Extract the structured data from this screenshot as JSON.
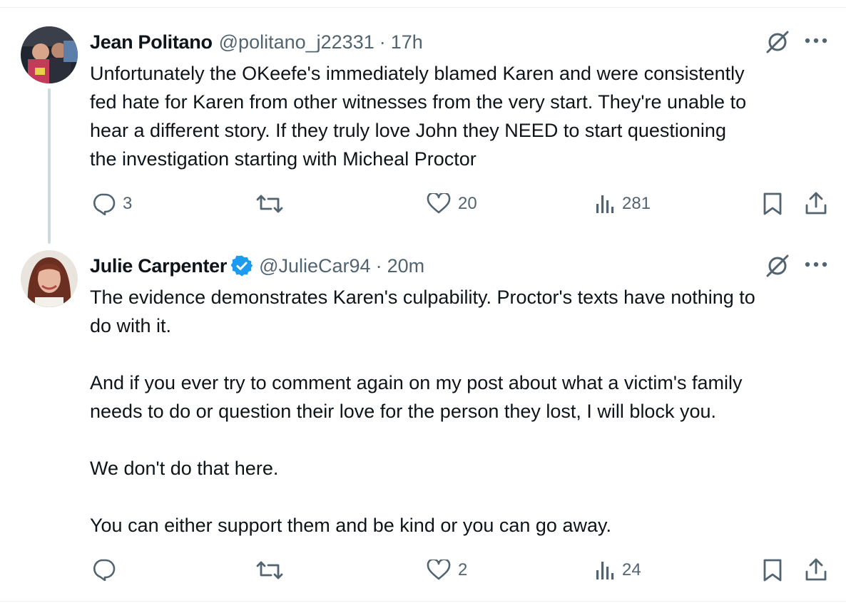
{
  "tweets": [
    {
      "name": "Jean Politano",
      "handle": "@politano_j22331",
      "separator": "·",
      "time": "17h",
      "verified": false,
      "text": "Unfortunately the OKeefe's immediately blamed Karen and were consistently\nfed hate for Karen from other witnesses from the very start. They're unable to\nhear a different story. If they truly love John they NEED to start questioning\nthe investigation starting with Micheal Proctor",
      "replies": "3",
      "reposts": "",
      "likes": "20",
      "views": "281"
    },
    {
      "name": "Julie Carpenter",
      "handle": "@JulieCar94",
      "separator": "·",
      "time": "20m",
      "verified": true,
      "text": "The evidence demonstrates Karen's culpability. Proctor's texts have nothing to\ndo with it.\n\nAnd if you ever try to comment again on my post about what a victim's family\nneeds to do or question their love for the person they lost, I will block you.\n\nWe don't do that here.\n\nYou can either support them and be kind or you can go away.",
      "replies": "",
      "reposts": "",
      "likes": "2",
      "views": "24"
    }
  ],
  "icons": {
    "grok": "grok-icon",
    "more": "more-icon",
    "reply": "reply-icon",
    "repost": "repost-icon",
    "like": "heart-icon",
    "views": "views-icon",
    "bookmark": "bookmark-icon",
    "share": "share-icon",
    "verified": "verified-badge-icon"
  },
  "colors": {
    "text": "#0f1419",
    "secondary": "#536471",
    "verified": "#1d9bf0",
    "thread_line": "#cfd9de"
  }
}
